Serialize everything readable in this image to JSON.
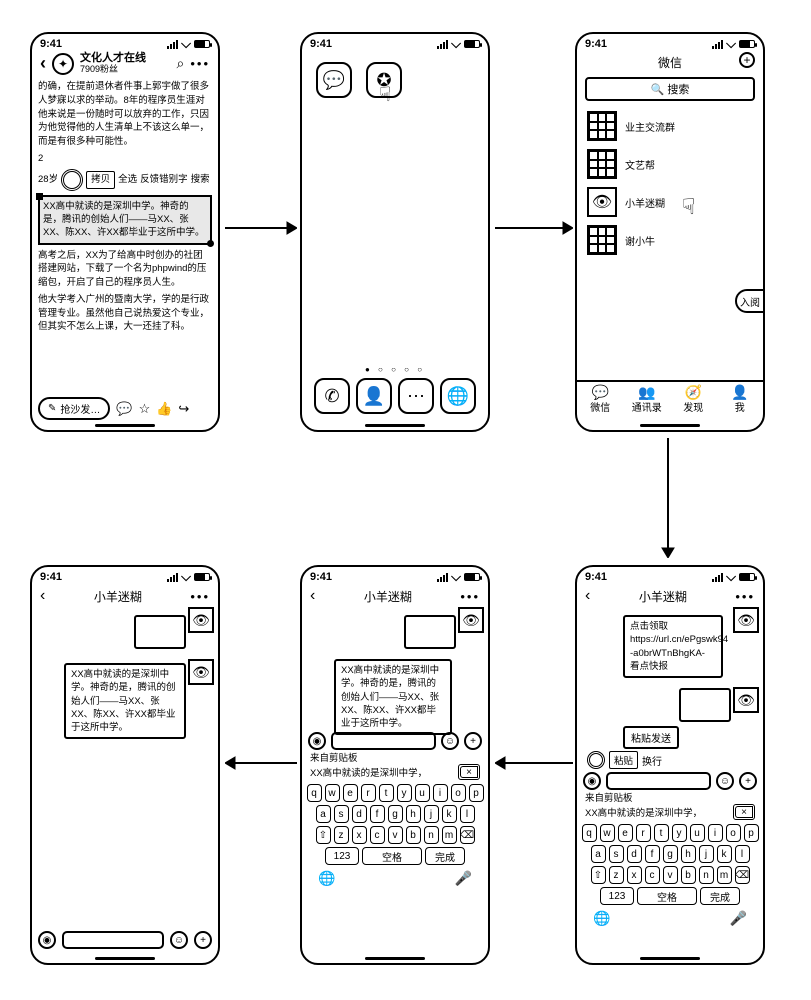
{
  "status": {
    "time": "9:41"
  },
  "p1": {
    "back": "‹",
    "title": "文化人才在线",
    "fans": "7909粉丝",
    "para1": "的确，在提前退休者件事上郭宇做了很多人梦寐以求的举动。8年的程序员生涯对他来说是一份随时可以放弃的工作，只因为他觉得他的人生清单上不该这么单一，而是有很多种可能性。",
    "two": "2",
    "line28": "28岁",
    "tool_copy": "拷贝",
    "tool_all": "全选",
    "tool_fb": "反馈错别字",
    "tool_search": "搜索",
    "highlight": "XX高中就读的是深圳中学。神奇的是，腾讯的创始人们——马XX、张XX、陈XX、许XX都毕业于这所中学。",
    "para2": "高考之后，XX为了给高中时创办的社团搭建网站，下载了一个名为phpwind的压缩包，开启了自己的程序员人生。",
    "para3": "他大学考入广州的暨南大学，学的是行政管理专业。虽然他自己说热爱这个专业，但其实不怎么上课，大一还挂了科。",
    "sofa": "抢沙发…"
  },
  "p3": {
    "app": "微信",
    "search": "搜索",
    "c1": "业主交流群",
    "c2": "文艺帮",
    "c3": "小羊迷糊",
    "c4": "谢小牛",
    "side": "入阅",
    "tab1": "微信",
    "tab2": "通讯录",
    "tab3": "发现",
    "tab4": "我"
  },
  "chat": {
    "title": "小羊迷糊",
    "url_msg_l1": "点击领取",
    "url_msg_l2": "https://url.cn/ePgswk94",
    "url_msg_l3": "-a0brWTnBhgKA-",
    "url_msg_l4": "看点快报",
    "paste_send": "粘贴发送",
    "paste": "粘贴",
    "newline": "换行",
    "clip_label": "来自剪贴板",
    "clip_preview": "XX高中就读的是深圳中学，",
    "pasted_msg": "XX高中就读的是深圳中学。神奇的是，腾讯的创始人们——马XX、张XX、陈XX、许XX都毕业于这所中学。",
    "p6_msg": "XX高中就读的是深圳中学。神奇的是，腾讯的创始人们——马XX、张XX、陈XX、许XX都毕业于这所中学。"
  },
  "kbd": {
    "r1": [
      "q",
      "w",
      "e",
      "r",
      "t",
      "y",
      "u",
      "i",
      "o",
      "p"
    ],
    "r2": [
      "a",
      "s",
      "d",
      "f",
      "g",
      "h",
      "j",
      "k",
      "l"
    ],
    "r3_shift": "⇧",
    "r3": [
      "z",
      "x",
      "c",
      "v",
      "b",
      "n",
      "m"
    ],
    "k123": "123",
    "space": "空格",
    "done": "完成"
  }
}
